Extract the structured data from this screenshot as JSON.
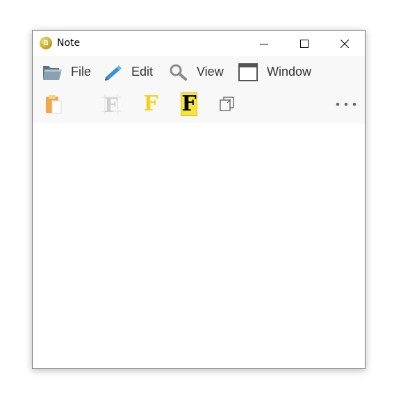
{
  "window": {
    "title": "Note",
    "app_icon_letter": "a",
    "controls": {
      "minimize": "minimize-icon",
      "maximize": "maximize-icon",
      "close": "close-icon"
    }
  },
  "menu": {
    "items": [
      {
        "label": "File",
        "icon": "folder-icon"
      },
      {
        "label": "Edit",
        "icon": "pencil-icon"
      },
      {
        "label": "View",
        "icon": "magnifier-icon"
      },
      {
        "label": "Window",
        "icon": "window-icon"
      }
    ]
  },
  "toolbar": {
    "items": [
      {
        "icon": "paste-icon"
      },
      {
        "icon": "font-outline-icon",
        "glyph": "F"
      },
      {
        "icon": "font-color-icon",
        "glyph": "F"
      },
      {
        "icon": "font-highlight-icon",
        "glyph": "F"
      },
      {
        "icon": "copy-icon"
      },
      {
        "icon": "more-icon"
      }
    ]
  },
  "colors": {
    "accent_yellow": "#f2d21c",
    "highlight_yellow": "#f7e53b",
    "menubar_bg": "#f8f8f8"
  }
}
